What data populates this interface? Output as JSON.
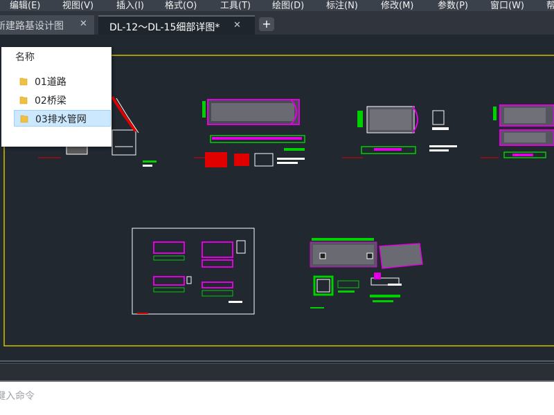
{
  "menubar": {
    "items": [
      "编辑(E)",
      "视图(V)",
      "插入(I)",
      "格式(O)",
      "工具(T)",
      "绘图(D)",
      "标注(N)",
      "修改(M)",
      "参数(P)",
      "窗口(W)",
      "帮"
    ]
  },
  "tabs": [
    {
      "label": "新建路基设计图",
      "close": "✕"
    },
    {
      "label": "DL-12～DL-15细部详图*",
      "close": "✕"
    }
  ],
  "new_tab": "+",
  "file_panel": {
    "header": "名称",
    "items": [
      "01道路",
      "02桥梁",
      "03排水管网"
    ],
    "selected": "03排水管网"
  },
  "command_line": {
    "placeholder": "键入命令"
  },
  "colors": {
    "canvas_bg": "#212830",
    "frame": "#d4c000",
    "magenta": "#e000e0",
    "green": "#00d000",
    "red": "#e00000",
    "white": "#ffffff",
    "selection": "#cce8ff"
  }
}
